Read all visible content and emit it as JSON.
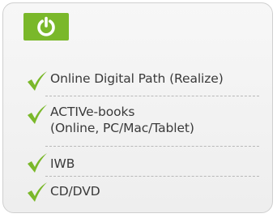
{
  "badge": {
    "icon": "power-icon",
    "color": "#7ab82a"
  },
  "check_icon": "checkmark-icon",
  "check_color": "#7ab82a",
  "features": [
    {
      "lines": [
        "Online Digital Path (Realize)"
      ]
    },
    {
      "lines": [
        "ACTIVe-books",
        "(Online, PC/Mac/Tablet)"
      ]
    },
    {
      "lines": [
        "IWB"
      ]
    },
    {
      "lines": [
        "CD/DVD"
      ]
    }
  ]
}
